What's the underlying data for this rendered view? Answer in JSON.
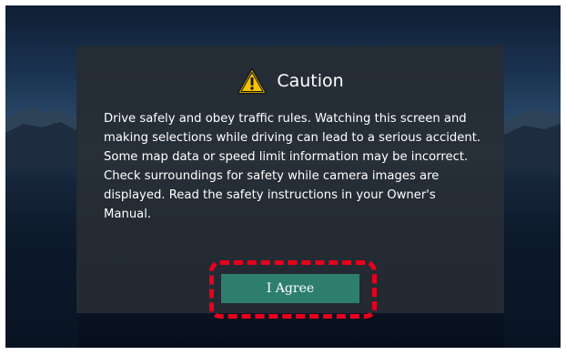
{
  "dialog": {
    "title": "Caution",
    "icon": "warning-triangle-icon",
    "message": "Drive safely and obey traffic rules. Watching this screen and making selections while driving can lead to a serious accident. Some map data or speed limit information may be incorrect. Check surroundings for safety while camera images are displayed. Read the safety instructions in your Owner's Manual.",
    "agree_label": "I Agree"
  },
  "colors": {
    "button": "#2e7e70",
    "highlight": "#e8001c",
    "warning_fill": "#f5c400",
    "dialog_bg": "#262c34"
  }
}
